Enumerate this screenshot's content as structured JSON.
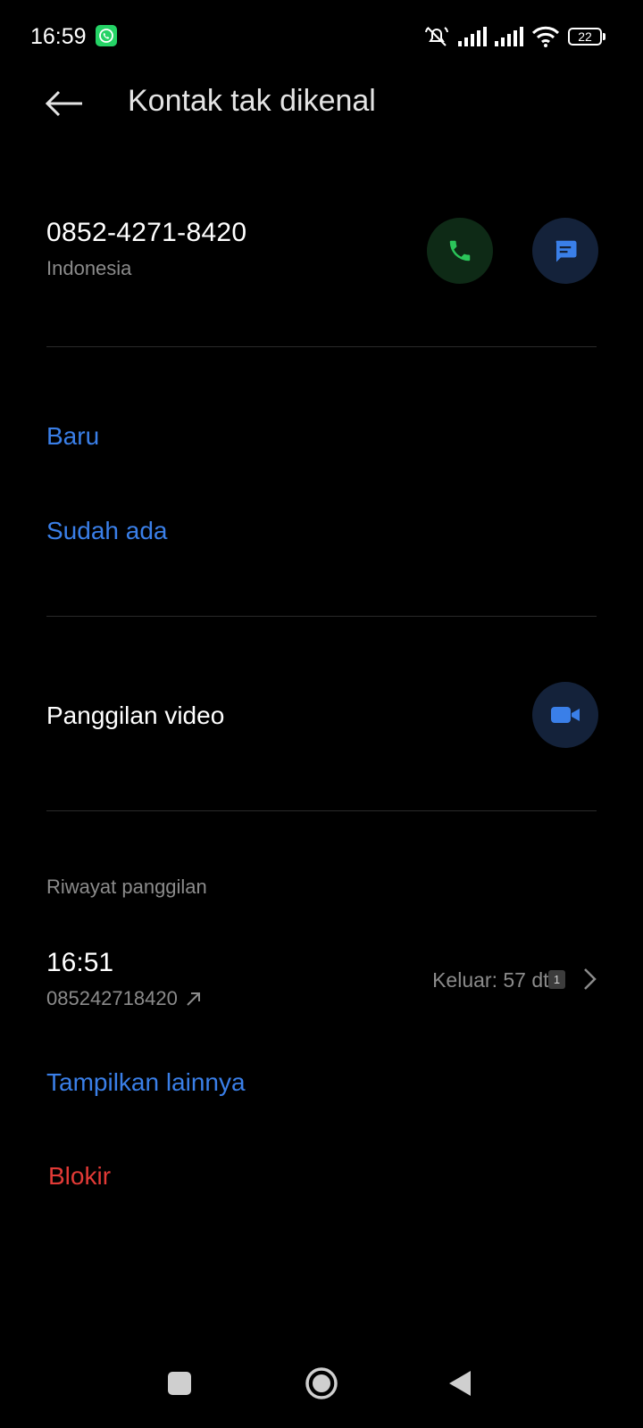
{
  "status_bar": {
    "time": "16:59",
    "battery": "22",
    "icons": [
      "whatsapp-icon",
      "mute-icon",
      "signal-icon",
      "signal-icon",
      "wifi-icon",
      "battery-icon"
    ]
  },
  "header": {
    "title": "Kontak tak dikenal",
    "back_icon": "arrow-left-icon"
  },
  "contact": {
    "number": "0852-4271-8420",
    "country": "Indonesia",
    "call_icon": "phone-icon",
    "message_icon": "message-icon"
  },
  "add_options": {
    "new": "Baru",
    "existing": "Sudah ada"
  },
  "video": {
    "label": "Panggilan video",
    "icon": "video-camera-icon"
  },
  "history": {
    "section_label": "Riwayat panggilan",
    "entries": [
      {
        "time": "16:51",
        "number": "085242718420",
        "direction_icon": "outgoing-arrow-icon",
        "info": "Keluar: 57 dtk",
        "sim": "1"
      }
    ],
    "show_more": "Tampilkan lainnya"
  },
  "block_label": "Blokir",
  "colors": {
    "accent": "#3a7fe8",
    "danger": "#e23a36",
    "call_green": "#2bc55a",
    "background": "#000000"
  }
}
